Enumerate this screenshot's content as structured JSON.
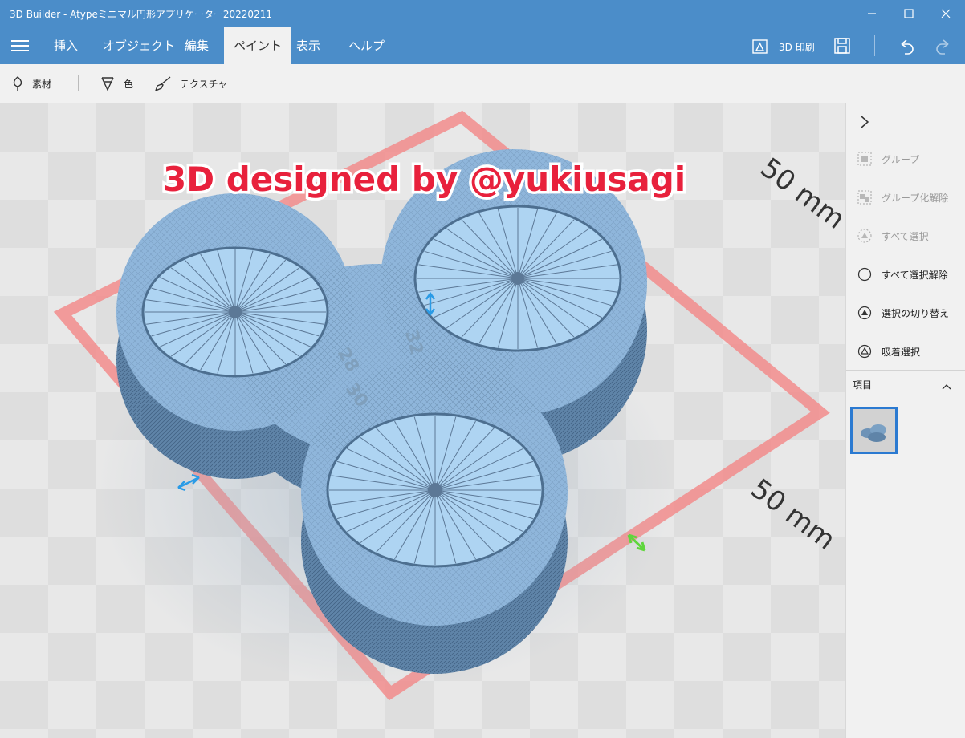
{
  "window": {
    "title": "3D Builder - Atypeミニマル円形アプリケーター20220211"
  },
  "menu": {
    "tabs": [
      {
        "label": "挿入"
      },
      {
        "label": "オブジェクト"
      },
      {
        "label": "編集"
      },
      {
        "label": "ペイント"
      },
      {
        "label": "表示"
      },
      {
        "label": "ヘルプ"
      }
    ],
    "active_tab": "ペイント",
    "print_label": "3D 印刷"
  },
  "toolbar": {
    "material_label": "素材",
    "color_label": "色",
    "texture_label": "テクスチャ"
  },
  "viewport": {
    "banner_text": "3D designed by @yukiusagi",
    "dim_label_top": "50 mm",
    "dim_label_bottom": "50 mm",
    "engraved_1": "28",
    "engraved_2": "32",
    "engraved_3": "30"
  },
  "panel": {
    "actions": [
      {
        "label": "グループ",
        "enabled": false
      },
      {
        "label": "グループ化解除",
        "enabled": false
      },
      {
        "label": "すべて選択",
        "enabled": false
      },
      {
        "label": "すべて選択解除",
        "enabled": true
      },
      {
        "label": "選択の切り替え",
        "enabled": true
      },
      {
        "label": "吸着選択",
        "enabled": true
      }
    ],
    "items_header": "項目"
  },
  "colors": {
    "accent": "#4b8dc9",
    "plate_outline": "#f28c8c",
    "model": "#8fb6db",
    "banner": "#e8213c"
  }
}
